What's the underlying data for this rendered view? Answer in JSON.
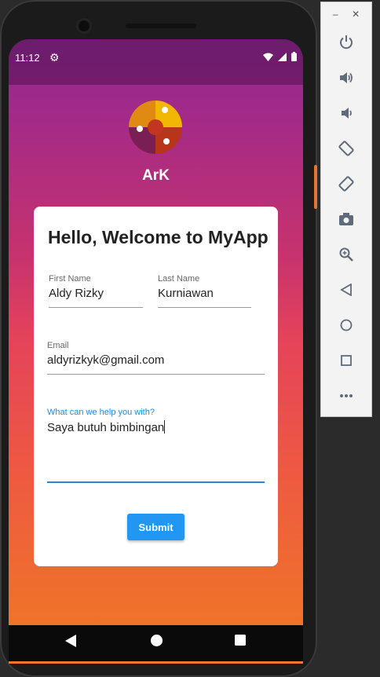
{
  "status_bar": {
    "time": "11:12"
  },
  "app": {
    "name": "ArK"
  },
  "form": {
    "heading": "Hello, Welcome to MyApp",
    "first_name": {
      "label": "First Name",
      "value": "Aldy Rizky"
    },
    "last_name": {
      "label": "Last Name",
      "value": "Kurniawan"
    },
    "email": {
      "label": "Email",
      "value": "aldyrizkyk@gmail.com"
    },
    "message": {
      "label": "What can we help you with?",
      "value": "Saya butuh bimbingan"
    },
    "submit_label": "Submit"
  },
  "emulator_toolbar": {
    "window_controls": [
      "minimize-icon",
      "close-icon"
    ],
    "buttons": [
      "power-icon",
      "volume-up-icon",
      "volume-down-icon",
      "rotate-left-icon",
      "rotate-right-icon",
      "camera-icon",
      "zoom-icon",
      "back-icon",
      "home-icon",
      "overview-icon",
      "more-icon"
    ]
  },
  "colors": {
    "accent": "#2196f3",
    "gradient_top": "#8b2a8f",
    "gradient_mid": "#e5435a",
    "gradient_bottom": "#f07a23"
  }
}
